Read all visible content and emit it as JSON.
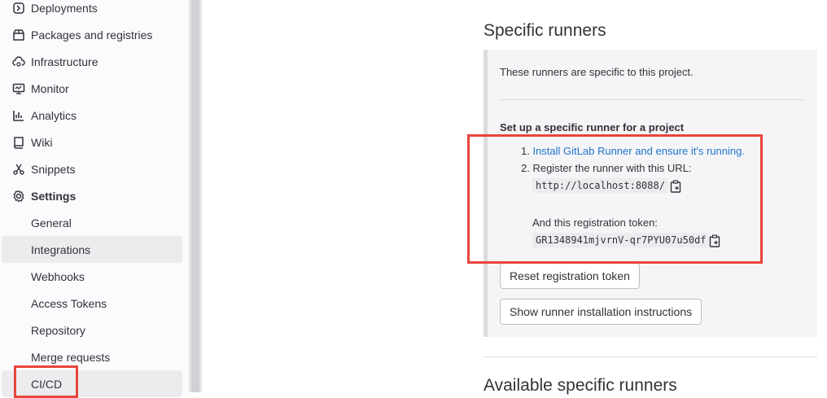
{
  "sidebar": {
    "items": [
      {
        "label": "Deployments",
        "icon": "deployments-icon"
      },
      {
        "label": "Packages and registries",
        "icon": "package-icon"
      },
      {
        "label": "Infrastructure",
        "icon": "cloud-gear-icon"
      },
      {
        "label": "Monitor",
        "icon": "monitor-icon"
      },
      {
        "label": "Analytics",
        "icon": "chart-icon"
      },
      {
        "label": "Wiki",
        "icon": "book-icon"
      },
      {
        "label": "Snippets",
        "icon": "scissors-icon"
      },
      {
        "label": "Settings",
        "icon": "settings-icon"
      }
    ],
    "subitems": [
      {
        "label": "General"
      },
      {
        "label": "Integrations"
      },
      {
        "label": "Webhooks"
      },
      {
        "label": "Access Tokens"
      },
      {
        "label": "Repository"
      },
      {
        "label": "Merge requests"
      },
      {
        "label": "CI/CD"
      }
    ]
  },
  "runners": {
    "title": "Specific runners",
    "intro": "These runners are specific to this project.",
    "setup_heading": "Set up a specific runner for a project",
    "step1_prefix": "1. ",
    "step1_link": "Install GitLab Runner and ensure it's running.",
    "step2": "2. Register the runner with this URL:",
    "url": "http://localhost:8088/",
    "token_label": "And this registration token:",
    "token": "GR1348941mjvrnV-qr7PYU07u50df",
    "reset_button": "Reset registration token",
    "show_button": "Show runner installation instructions"
  },
  "available": {
    "title": "Available specific runners"
  },
  "colors": {
    "highlight": "#e8453c",
    "link": "#1f75cb"
  }
}
